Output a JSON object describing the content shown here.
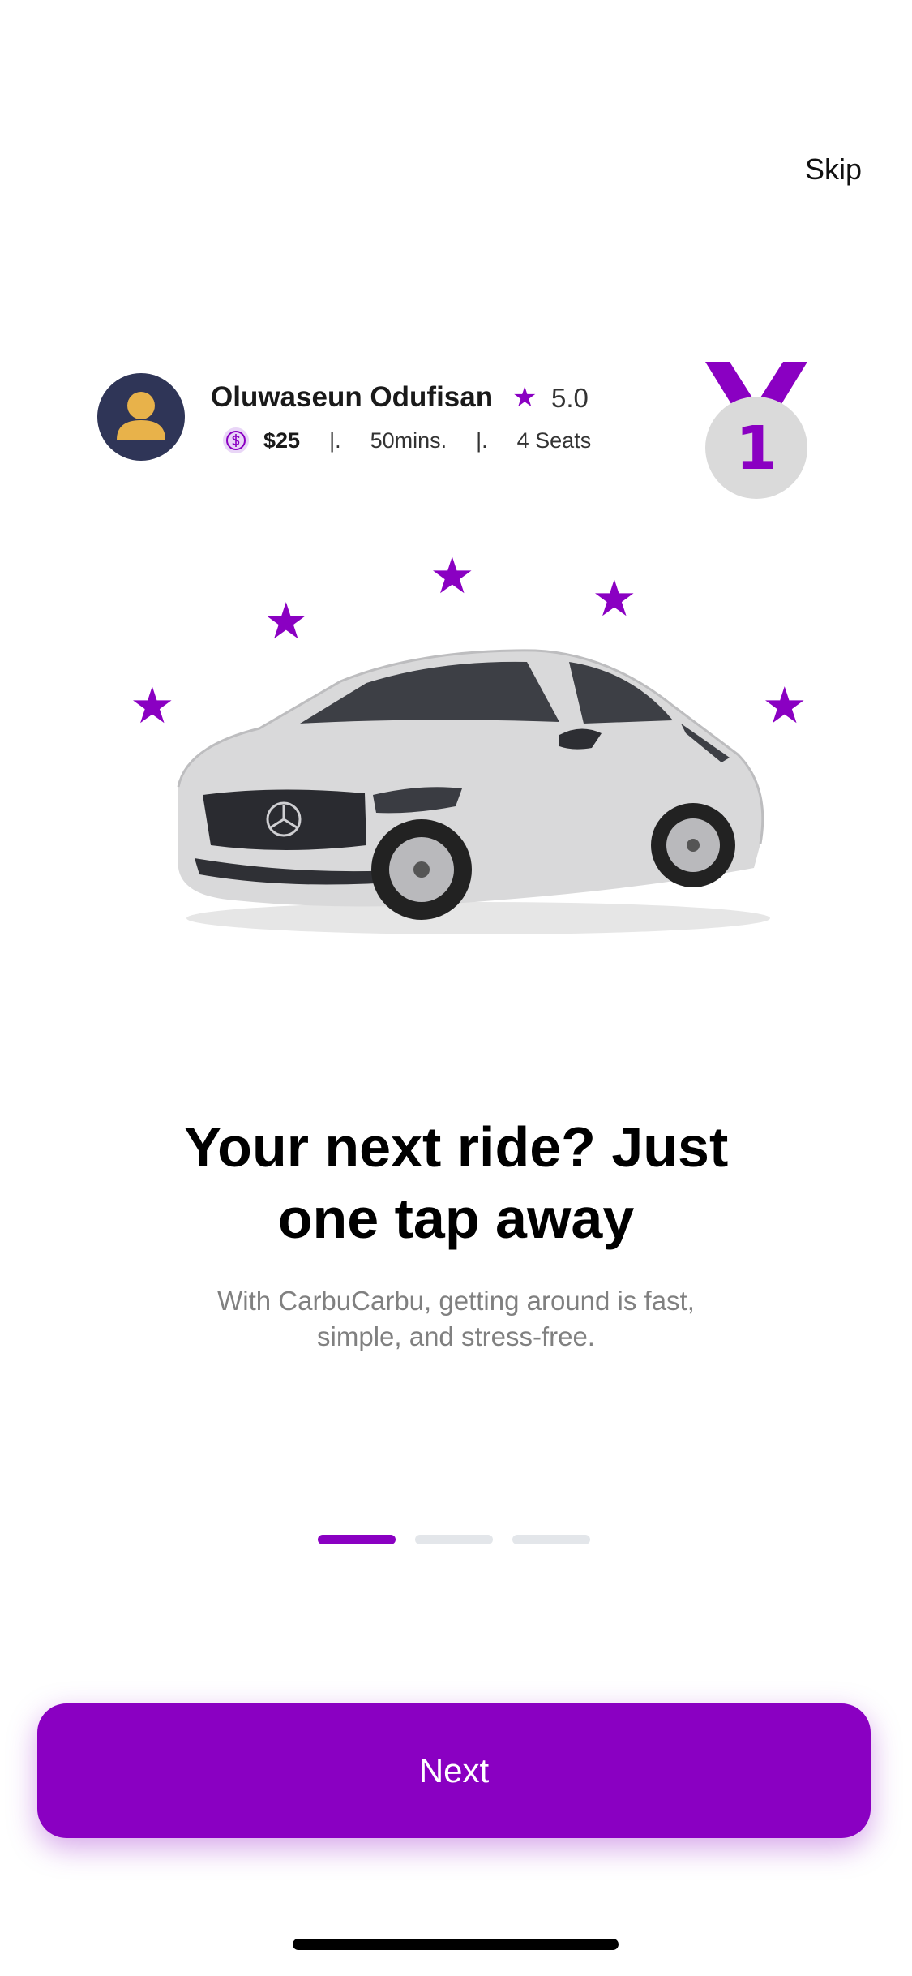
{
  "header": {
    "skip_label": "Skip"
  },
  "driver_card": {
    "name": "Oluwaseun Odufisan",
    "rating": "5.0",
    "price": "$25",
    "separator": "|.",
    "duration": "50mins.",
    "seats": "4 Seats",
    "avatar_icon": "person-icon",
    "coin_icon": "dollar-coin-icon"
  },
  "medal": {
    "rank": "1",
    "icon": "medal-icon"
  },
  "hero": {
    "car_icon": "car-illustration",
    "star_icon": "star-icon"
  },
  "content": {
    "headline_line1": "Your next ride? Just",
    "headline_line2": "one tap away",
    "subtext_line1": "With CarbuCarbu, getting around is fast,",
    "subtext_line2": "simple, and stress-free."
  },
  "pagination": {
    "total": 3,
    "active_index": 0
  },
  "footer": {
    "next_label": "Next"
  },
  "colors": {
    "accent": "#8A00C2",
    "indicator_inactive": "#E3E6EA",
    "subtext": "#808080",
    "avatar_bg": "#2F3557",
    "avatar_person": "#E8B24A",
    "medal_disc": "#DADADA"
  }
}
